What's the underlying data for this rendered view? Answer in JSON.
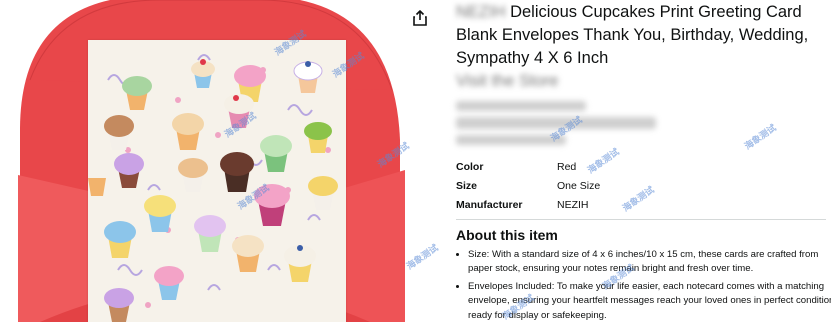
{
  "product": {
    "title_brand": "NEZIH",
    "title": "Delicious Cupcakes Print Greeting Card Blank Envelopes Thank You, Birthday, Wedding, Sympathy 4 X 6 Inch",
    "title_suffix": "Visit the Store"
  },
  "specs": [
    {
      "key": "Color",
      "value": "Red"
    },
    {
      "key": "Size",
      "value": "One Size"
    },
    {
      "key": "Manufacturer",
      "value": "NEZIH"
    }
  ],
  "about": {
    "heading": "About this item",
    "bullets": [
      "Size: With a standard size of 4 x 6 inches/10 x 15 cm, these cards are crafted from paper stock, ensuring your notes remain bright and fresh over time.",
      "Envelopes Included: To make your life easier, each notecard comes with a matching envelope, ensuring your heartfelt messages reach your loved ones in perfect condition, ready for display or safekeeping."
    ]
  },
  "watermark_text": "海象测试",
  "colors": {
    "envelope": "#e8474a",
    "envelope_dark": "#d23a3e",
    "card": "#f6f2ea"
  },
  "icons": {
    "share": "share-icon"
  }
}
